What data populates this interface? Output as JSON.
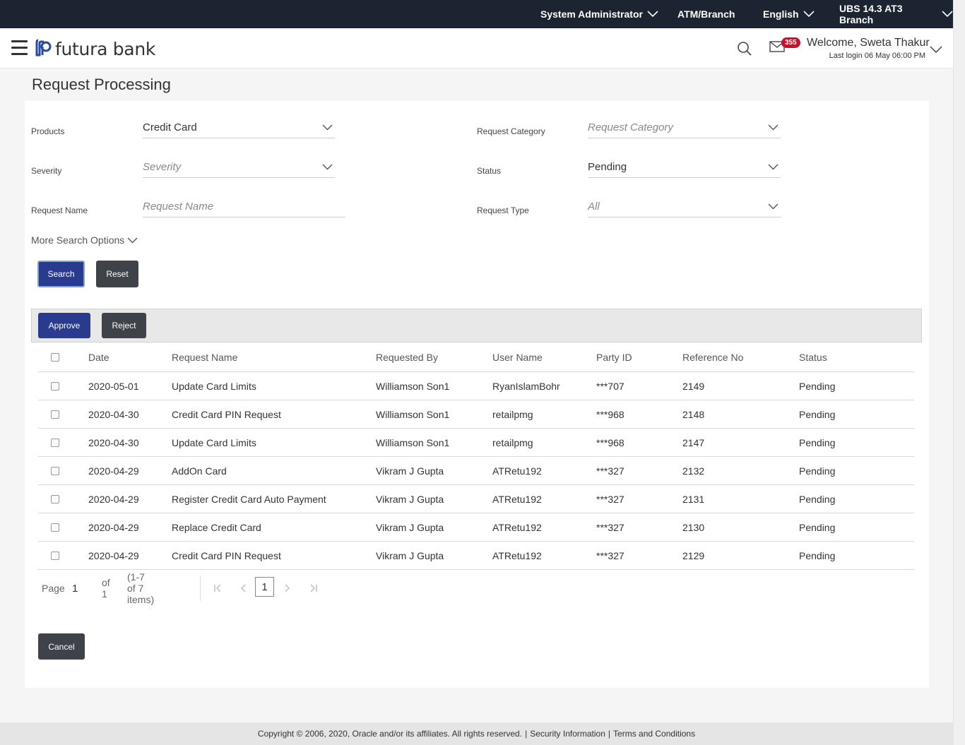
{
  "topbar": {
    "role": "System Administrator",
    "channel": "ATM/Branch",
    "language": "English",
    "entity": "UBS 14.3 AT3 Branch"
  },
  "header": {
    "brand": "futura bank",
    "notification_count": "355",
    "welcome": "Welcome, Sweta Thakur",
    "last_login": "Last login 06 May 06:00 PM"
  },
  "page": {
    "title": "Request Processing"
  },
  "filters": {
    "products_label": "Products",
    "products_value": "Credit Card",
    "category_label": "Request Category",
    "category_placeholder": "Request Category",
    "severity_label": "Severity",
    "severity_placeholder": "Severity",
    "status_label": "Status",
    "status_value": "Pending",
    "name_label": "Request Name",
    "name_placeholder": "Request Name",
    "type_label": "Request Type",
    "type_placeholder": "All",
    "more_options": "More Search Options",
    "search_btn": "Search",
    "reset_btn": "Reset"
  },
  "actions": {
    "approve": "Approve",
    "reject": "Reject"
  },
  "table": {
    "headers": [
      "Date",
      "Request Name",
      "Requested By",
      "User Name",
      "Party ID",
      "Reference No",
      "Status"
    ],
    "rows": [
      [
        "2020-05-01",
        "Update Card Limits",
        "Williamson Son1",
        "RyanIslamBohr",
        "***707",
        "2149",
        "Pending"
      ],
      [
        "2020-04-30",
        "Credit Card PIN Request",
        "Williamson Son1",
        "retailpmg",
        "***968",
        "2148",
        "Pending"
      ],
      [
        "2020-04-30",
        "Update Card Limits",
        "Williamson Son1",
        "retailpmg",
        "***968",
        "2147",
        "Pending"
      ],
      [
        "2020-04-29",
        "AddOn Card",
        "Vikram J Gupta",
        "ATRetu192",
        "***327",
        "2132",
        "Pending"
      ],
      [
        "2020-04-29",
        "Register Credit Card Auto Payment",
        "Vikram J Gupta",
        "ATRetu192",
        "***327",
        "2131",
        "Pending"
      ],
      [
        "2020-04-29",
        "Replace Credit Card",
        "Vikram J Gupta",
        "ATRetu192",
        "***327",
        "2130",
        "Pending"
      ],
      [
        "2020-04-29",
        "Credit Card PIN Request",
        "Vikram J Gupta",
        "ATRetu192",
        "***327",
        "2129",
        "Pending"
      ]
    ]
  },
  "pagination": {
    "page_label": "Page",
    "page_value": "1",
    "of_label": "of 1",
    "items_label": "(1-7 of 7 items)",
    "current_page": "1"
  },
  "cancel_btn": "Cancel",
  "footer": {
    "copyright": "Copyright © 2006, 2020, Oracle and/or its affiliates. All rights reserved.",
    "separator": "|",
    "security": "Security Information",
    "terms": "Terms and Conditions"
  },
  "colors": {
    "topbar_bg": "#1c2331",
    "primary_button": "#2a3b8f",
    "dark_button": "#3f4249",
    "badge": "#c8102e"
  }
}
